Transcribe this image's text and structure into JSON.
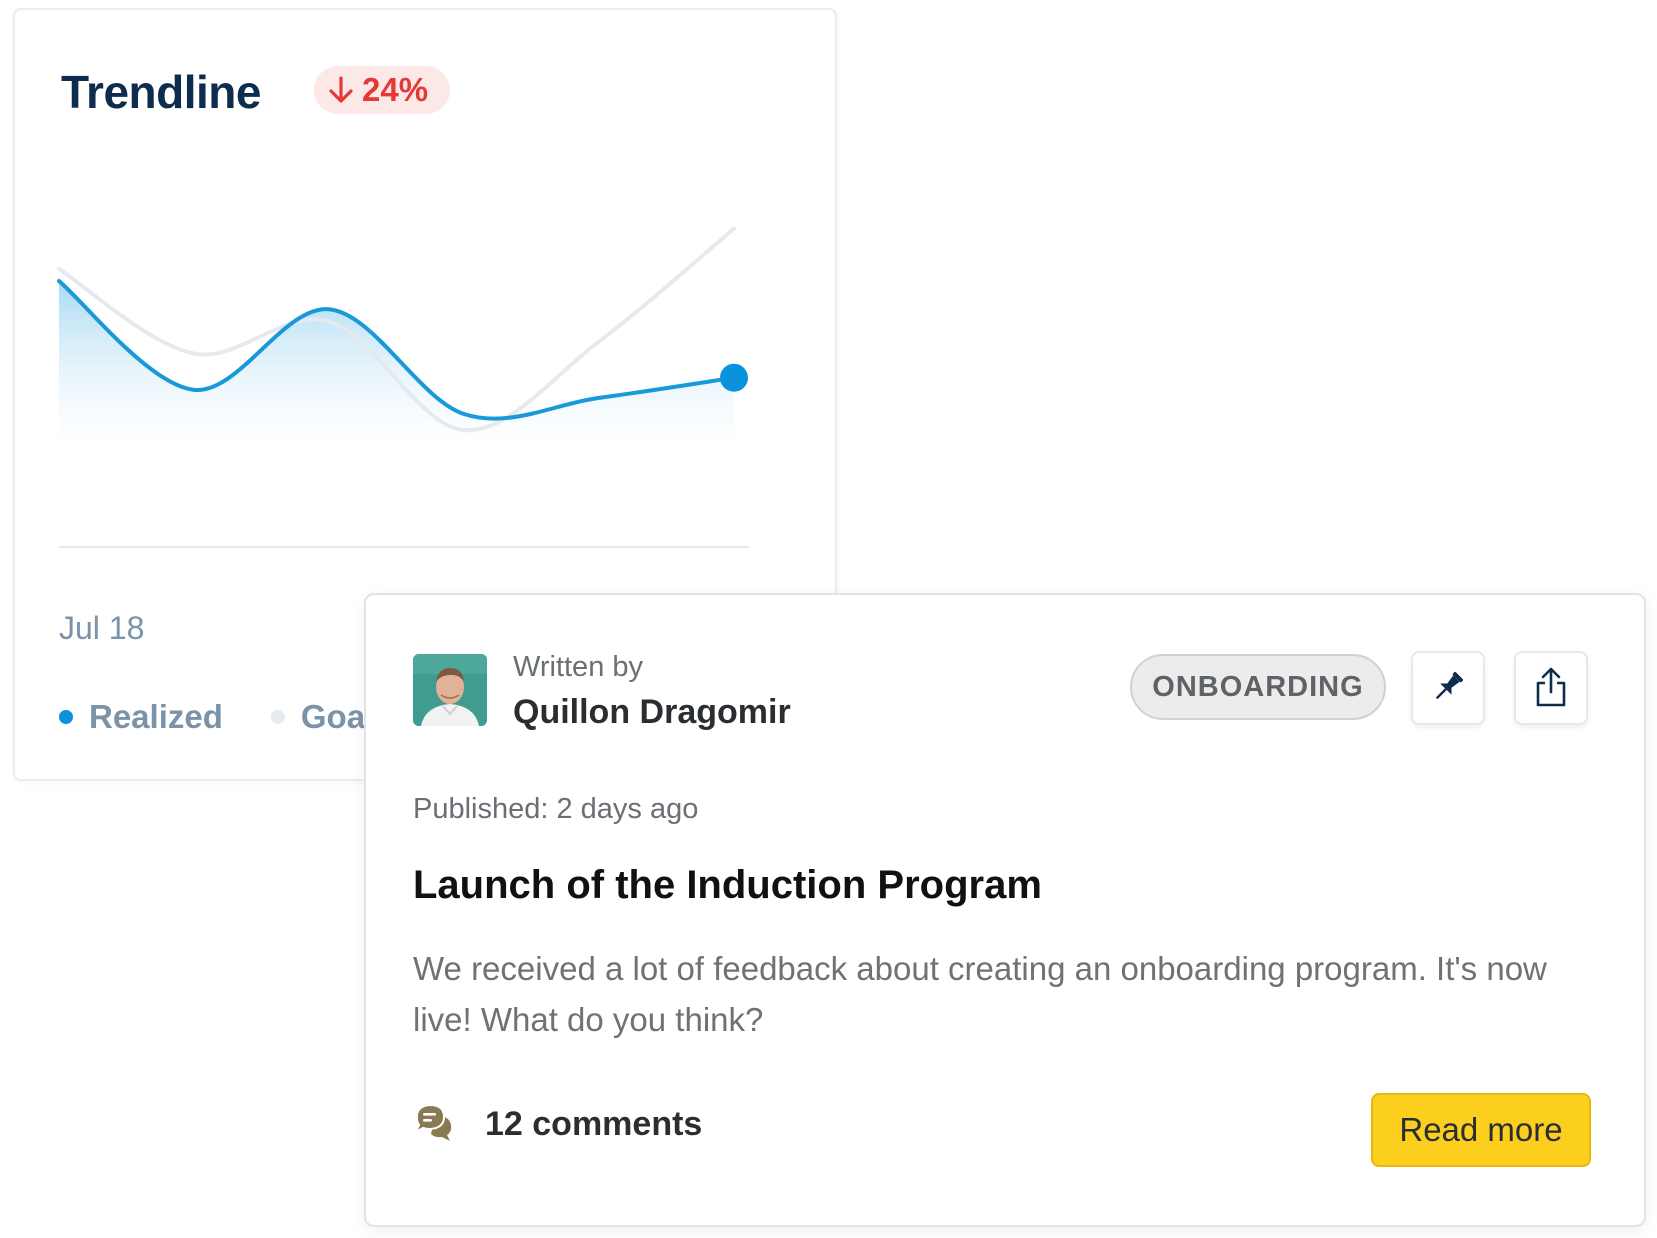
{
  "trendline_card": {
    "title": "Trendline",
    "change_badge": {
      "direction": "down",
      "value": "24%",
      "color": "#e53935"
    },
    "date_label": "Jul 18",
    "legend": [
      {
        "label": "Realized",
        "color": "#0a93dd"
      },
      {
        "label": "Goal",
        "color": "#e4eaee"
      }
    ],
    "chart_data": {
      "type": "line",
      "x": [
        0,
        1,
        2,
        3,
        4,
        5
      ],
      "series": [
        {
          "name": "Realized",
          "values": [
            66,
            39,
            59,
            33,
            37,
            42
          ]
        },
        {
          "name": "Goal",
          "values": [
            69,
            48,
            56,
            29,
            51,
            79
          ]
        }
      ],
      "ylim": [
        0,
        100
      ],
      "grid": false,
      "highlight_last_point": true,
      "area_fill_series": "Realized"
    }
  },
  "post_card": {
    "written_by_label": "Written by",
    "author_name": "Quillon Dragomir",
    "tag": "ONBOARDING",
    "published": "Published: 2 days ago",
    "title": "Launch of the Induction Program",
    "body": "We received a lot of feedback about creating an onboarding program. It's now live! What do you think?",
    "comments_label": "12 comments",
    "read_more_label": "Read more",
    "icons": {
      "pin": "pin-icon",
      "share": "share-icon",
      "comments": "comments-icon"
    },
    "accent_color": "#fccf1f"
  }
}
